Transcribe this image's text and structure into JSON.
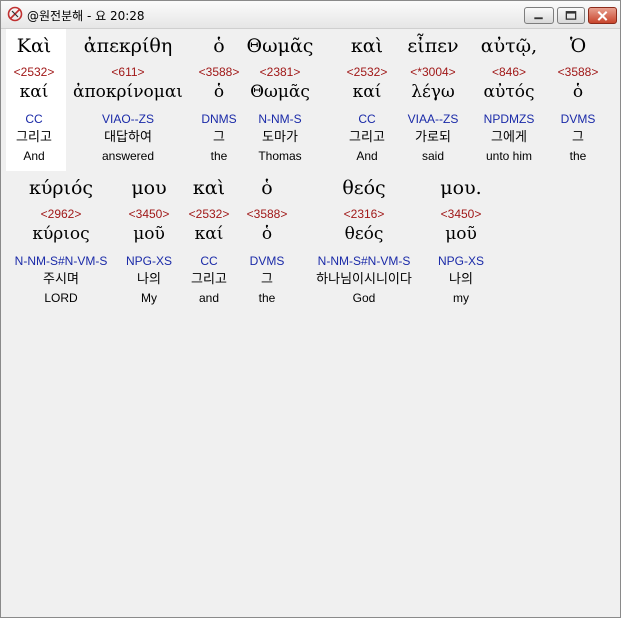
{
  "window": {
    "title": "@원전분해 - 요 20:28",
    "buttons": {
      "minimize": "minimize",
      "maximize": "maximize",
      "close": "close"
    }
  },
  "rows": [
    {
      "words": [
        {
          "greek": "Καὶ",
          "strong": "<2532>",
          "lemma": "καί",
          "morph": "CC",
          "korean": "그리고",
          "english": "And"
        },
        {
          "greek": "ἀπεκρίθη",
          "strong": "<611>",
          "lemma": "ἀποκρίνομαι",
          "morph": "VIAO--ZS",
          "korean": "대답하여",
          "english": "answered"
        },
        {
          "greek": "ὁ",
          "strong": "<3588>",
          "lemma": "ὁ",
          "morph": "DNMS",
          "korean": "그",
          "english": "the"
        },
        {
          "greek": "Θωμᾶς",
          "strong": "<2381>",
          "lemma": "Θωμᾶς",
          "morph": "N-NM-S",
          "korean": "도마가",
          "english": "Thomas"
        },
        {
          "greek": "καὶ",
          "strong": "<2532>",
          "lemma": "καί",
          "morph": "CC",
          "korean": "그리고",
          "english": "And"
        },
        {
          "greek": "εἶπεν",
          "strong": "<*3004>",
          "lemma": "λέγω",
          "morph": "VIAA--ZS",
          "korean": "가로되",
          "english": "said"
        },
        {
          "greek": "αὐτῷ,",
          "strong": "<846>",
          "lemma": "αὐτός",
          "morph": "NPDMZS",
          "korean": "그에게",
          "english": "unto him"
        },
        {
          "greek": "Ὁ",
          "strong": "<3588>",
          "lemma": "ὁ",
          "morph": "DVMS",
          "korean": "그",
          "english": "the"
        }
      ]
    },
    {
      "words": [
        {
          "greek": "κύριός",
          "strong": "<2962>",
          "lemma": "κύριος",
          "morph": "N-NM-S#N-VM-S",
          "korean": "주시며",
          "english": "LORD"
        },
        {
          "greek": "μου",
          "strong": "<3450>",
          "lemma": "μοῦ",
          "morph": "NPG-XS",
          "korean": "나의",
          "english": "My"
        },
        {
          "greek": "καὶ",
          "strong": "<2532>",
          "lemma": "καί",
          "morph": "CC",
          "korean": "그리고",
          "english": "and"
        },
        {
          "greek": "ὁ",
          "strong": "<3588>",
          "lemma": "ὁ",
          "morph": "DVMS",
          "korean": "그",
          "english": "the"
        },
        {
          "greek": "θεός",
          "strong": "<2316>",
          "lemma": "θεός",
          "morph": "N-NM-S#N-VM-S",
          "korean": "하나님이시니이다",
          "english": "God"
        },
        {
          "greek": "μου.",
          "strong": "<3450>",
          "lemma": "μοῦ",
          "morph": "NPG-XS",
          "korean": "나의",
          "english": "my"
        }
      ]
    }
  ]
}
